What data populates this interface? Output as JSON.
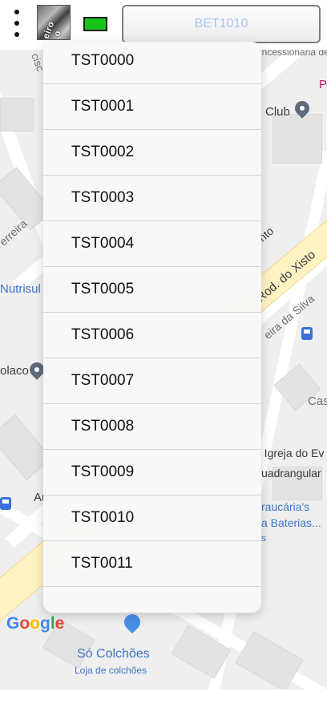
{
  "toolbar": {
    "menu_icon": "vertical-dots-icon",
    "map_thumbnail_text": "eiro Lo",
    "battery_color": "#18c418",
    "device_value": "BET1010"
  },
  "map": {
    "labels": {
      "concessionaria": "oncessionária de",
      "club": "Club",
      "p_letter": "P",
      "ferreira": "erreira",
      "nutrisul": "Nutrisul A",
      "rod_xisto": "Rod. do Xisto",
      "to": "nto",
      "silva": "eira da Silva",
      "placo": "olaco",
      "cas": "Cas",
      "igreja": "a Igreja do Ev",
      "quadrangular": "uadrangular",
      "araucaria": "raucária's",
      "baterias": "a Baterias...",
      "s_letter": "s",
      "au": "Au",
      "ciscc": "cisc",
      "colchoes": "Só Colchões",
      "colchoes_sub": "Loja de colchões"
    },
    "logo": [
      "G",
      "o",
      "o",
      "g",
      "l",
      "e"
    ]
  },
  "dropdown": {
    "items": [
      "TST0000",
      "TST0001",
      "TST0002",
      "TST0003",
      "TST0004",
      "TST0005",
      "TST0006",
      "TST0007",
      "TST0008",
      "TST0009",
      "TST0010",
      "TST0011"
    ]
  }
}
